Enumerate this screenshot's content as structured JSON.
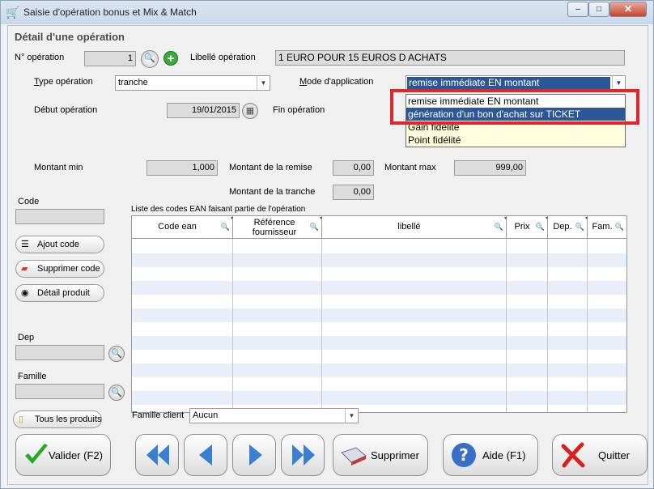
{
  "window": {
    "title": "Saisie d'opération bonus et Mix & Match",
    "min": "–",
    "max": "□",
    "close": "✕"
  },
  "section": {
    "title": "Détail d'une opération"
  },
  "form": {
    "num_op_label": "N° opération",
    "num_op_value": "1",
    "libelle_label": "Libellé opération",
    "libelle_value": "1 EURO POUR 15 EUROS D ACHATS",
    "type_label": "Type opération",
    "type_value": "tranche",
    "mode_label": "Mode d'application",
    "mode_value": "remise immédiate EN montant",
    "debut_label": "Début opération",
    "debut_value": "19/01/2015",
    "fin_label": "Fin opération",
    "montant_min_label": "Montant min",
    "montant_min_value": "1,000",
    "montant_remise_label": "Montant de la remise",
    "montant_remise_value": "0,00",
    "montant_max_label": "Montant max",
    "montant_max_value": "999,00",
    "montant_tranche_label": "Montant de la tranche",
    "montant_tranche_value": "0,00"
  },
  "dropdown": {
    "options": [
      "remise immédiate EN montant",
      "génération d'un bon d'achat sur TICKET",
      "Gain fidélité",
      "Point fidélité"
    ],
    "selected_index": 1
  },
  "left": {
    "code_label": "Code",
    "ajout_code": "Ajout code",
    "supprimer_code": "Supprimer code",
    "detail_produit": "Détail produit",
    "dep_label": "Dep",
    "famille_label": "Famille",
    "tous_produits": "Tous les produits"
  },
  "list": {
    "caption": "Liste des codes EAN faisant partie de l'opération",
    "columns": [
      "Code ean",
      "Référence fournisseur",
      "libellé",
      "Prix",
      "Dep.",
      "Fam."
    ]
  },
  "famille_client": {
    "label": "Famille client",
    "value": "Aucun"
  },
  "buttons": {
    "valider": "Valider (F2)",
    "supprimer": "Supprimer",
    "aide": "Aide (F1)",
    "quitter": "Quitter"
  },
  "colors": {
    "selected_option": "#2b5797",
    "highlight_box": "#e0262a",
    "valid_green": "#2aa82a",
    "nav_blue": "#3a7fd0",
    "quit_red": "#d8201e"
  }
}
